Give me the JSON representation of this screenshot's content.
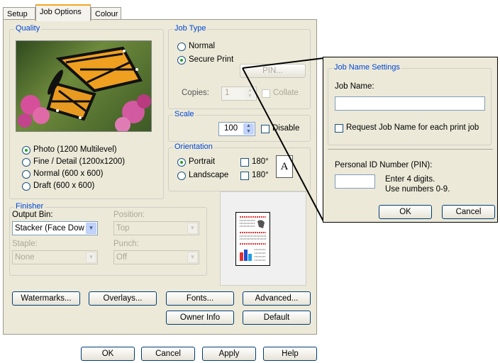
{
  "tabs": [
    "Setup",
    "Job Options",
    "Colour"
  ],
  "quality": {
    "title": "Quality",
    "options": [
      "Photo (1200 Multilevel)",
      "Fine / Detail (1200x1200)",
      "Normal (600 x 600)",
      "Draft (600 x 600)"
    ],
    "selected_index": 0
  },
  "job_type": {
    "title": "Job Type",
    "normal_label": "Normal",
    "secure_label": "Secure Print",
    "pin_button": "PIN...",
    "copies_label": "Copies:",
    "copies_value": "1",
    "collate_label": "Collate"
  },
  "scale": {
    "title": "Scale",
    "value": "100",
    "disable_label": "Disable"
  },
  "orientation": {
    "title": "Orientation",
    "portrait_label": "Portrait",
    "landscape_label": "Landscape",
    "rotate_label_1": "180°",
    "rotate_label_2": "180°",
    "preview_letter": "A"
  },
  "finisher": {
    "title": "Finisher",
    "output_bin_label": "Output Bin:",
    "output_bin_value": "Stacker (Face Dow",
    "position_label": "Position:",
    "position_value": "Top",
    "staple_label": "Staple:",
    "staple_value": "None",
    "punch_label": "Punch:",
    "punch_value": "Off"
  },
  "buttons": {
    "watermarks": "Watermarks...",
    "overlays": "Overlays...",
    "fonts": "Fonts...",
    "advanced": "Advanced...",
    "owner_info": "Owner Info",
    "default": "Default"
  },
  "footer": {
    "ok": "OK",
    "cancel": "Cancel",
    "apply": "Apply",
    "help": "Help"
  },
  "job_name_dialog": {
    "group_title": "Job Name Settings",
    "job_name_label": "Job Name:",
    "job_name_value": "",
    "request_label": "Request Job Name for each print job",
    "pin_label": "Personal ID Number (PIN):",
    "pin_value": "",
    "hint_line1": "Enter 4 digits.",
    "hint_line2": "Use numbers 0-9.",
    "ok": "OK",
    "cancel": "Cancel"
  },
  "colors": {
    "accent_tab": "#f5a623",
    "group_title": "#0046d5",
    "radio_dot": "#21a121"
  }
}
